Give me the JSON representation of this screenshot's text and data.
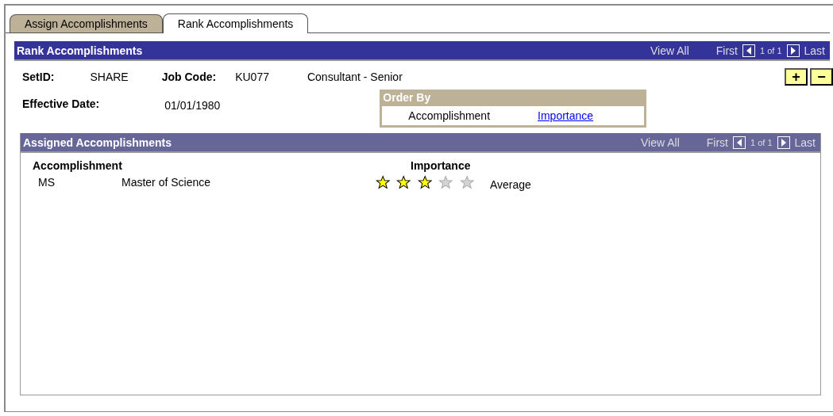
{
  "tabs": [
    {
      "label": "Assign Accomplishments",
      "selected": false
    },
    {
      "label": "Rank Accomplishments",
      "selected": true
    }
  ],
  "panel": {
    "title": "Rank Accomplishments",
    "nav": {
      "view_all": "View All",
      "first": "First",
      "count": "1 of 1",
      "last": "Last"
    }
  },
  "fields": {
    "setid_label": "SetID:",
    "setid": "SHARE",
    "job_code_label": "Job Code:",
    "job_code": "KU077",
    "job_title": "Consultant - Senior",
    "effective_date_label": "Effective Date:",
    "effective_date": "01/01/1980"
  },
  "buttons": [
    "+",
    "−"
  ],
  "order_by": {
    "title": "Order By",
    "options": [
      {
        "label": "Accomplishment",
        "selected": true
      },
      {
        "label": "Importance",
        "selected": false
      }
    ]
  },
  "assigned": {
    "title": "Assigned Accomplishments",
    "nav": {
      "view_all": "View All",
      "first": "First",
      "count": "1 of 1",
      "last": "Last"
    },
    "columns": [
      "Accomplishment",
      "Importance"
    ],
    "rows": [
      {
        "code": "MS",
        "name": "Master of Science",
        "stars": 3,
        "rating": "Average"
      }
    ]
  }
}
